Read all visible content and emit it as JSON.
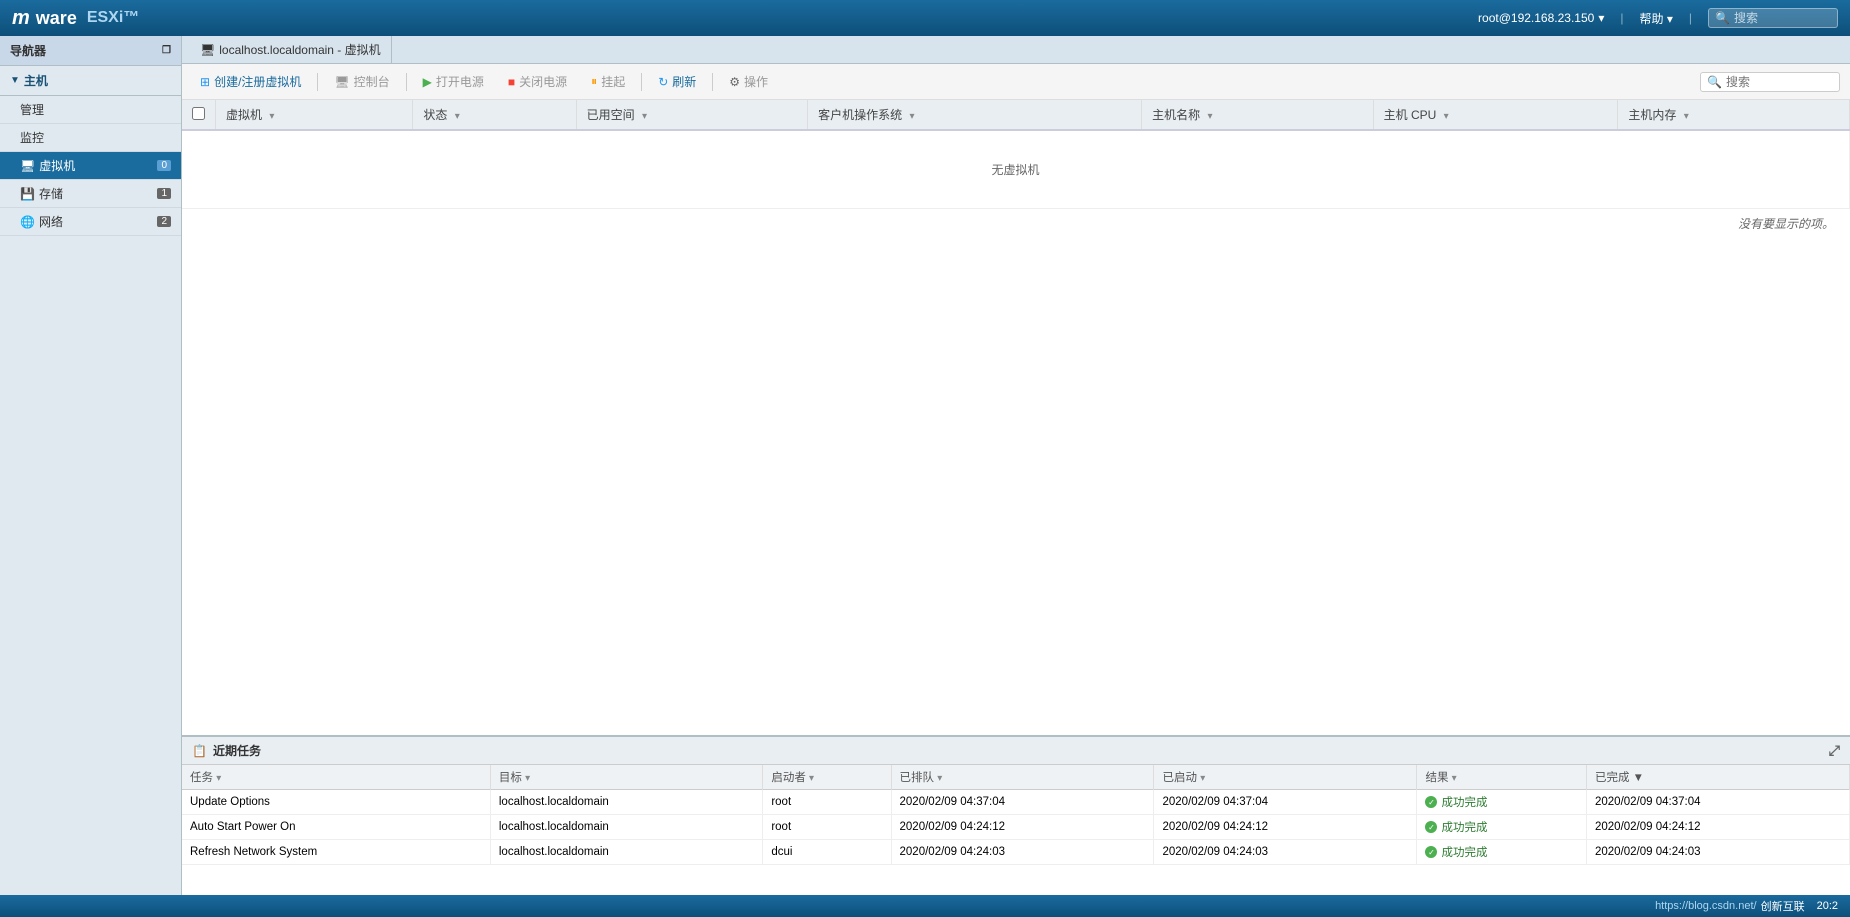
{
  "app": {
    "title": "VMware ESXi",
    "logo_main": "mware",
    "logo_sub": "ESXi™"
  },
  "header": {
    "user": "root@192.168.23.150",
    "user_dropdown": "▾",
    "help": "帮助",
    "help_dropdown": "▾",
    "search_placeholder": "搜索"
  },
  "sidebar": {
    "navigator_label": "导航器",
    "host_group": "主机",
    "manage_label": "管理",
    "monitor_label": "监控",
    "vm_label": "虚拟机",
    "vm_badge": "0",
    "storage_label": "存储",
    "storage_badge": "1",
    "network_label": "网络",
    "network_badge": "2"
  },
  "tab": {
    "icon": "🖥",
    "title": "localhost.localdomain - 虚拟机"
  },
  "toolbar": {
    "create_btn": "创建/注册虚拟机",
    "console_btn": "控制台",
    "power_on_btn": "打开电源",
    "power_off_btn": "关闭电源",
    "suspend_btn": "挂起",
    "refresh_btn": "刷新",
    "actions_btn": "操作",
    "search_placeholder": "搜索"
  },
  "table": {
    "columns": [
      "虚拟机",
      "状态",
      "已用空间",
      "客户机操作系统",
      "主机名称",
      "主机 CPU",
      "主机内存"
    ],
    "empty_msg": "无虚拟机",
    "no_items_msg": "没有要显示的项。"
  },
  "recent_tasks": {
    "title": "近期任务",
    "columns": [
      "任务",
      "目标",
      "启动者",
      "已排队",
      "已启动",
      "结果",
      "已完成 ▼"
    ],
    "rows": [
      {
        "task": "Update Options",
        "target": "localhost.localdomain",
        "initiator": "root",
        "queued": "2020/02/09 04:37:04",
        "started": "2020/02/09 04:37:04",
        "result": "成功完成",
        "completed": "2020/02/09 04:37:04"
      },
      {
        "task": "Auto Start Power On",
        "target": "localhost.localdomain",
        "initiator": "root",
        "queued": "2020/02/09 04:24:12",
        "started": "2020/02/09 04:24:12",
        "result": "成功完成",
        "completed": "2020/02/09 04:24:12"
      },
      {
        "task": "Refresh Network System",
        "target": "localhost.localdomain",
        "initiator": "dcui",
        "queued": "2020/02/09 04:24:03",
        "started": "2020/02/09 04:24:03",
        "result": "成功完成",
        "completed": "2020/02/09 04:24:03"
      }
    ]
  },
  "status_bar": {
    "link_text": "https://blog.csdn.net/",
    "extra": "创新互联"
  }
}
